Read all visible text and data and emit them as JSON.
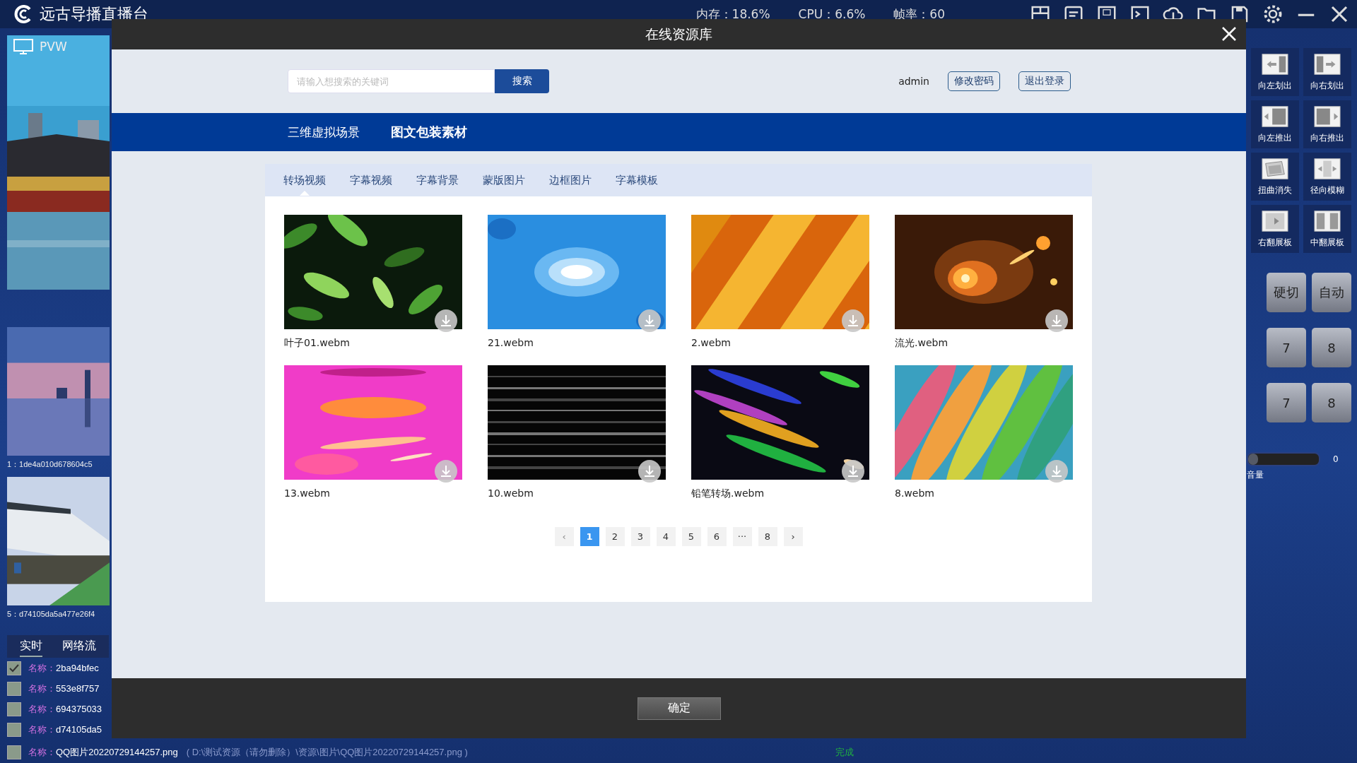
{
  "app": {
    "title": "远古导播直播台",
    "stats": [
      "内存：18.6%",
      "CPU：6.6%",
      "帧率：60"
    ]
  },
  "preview": {
    "label": "PVW"
  },
  "sources": [
    {
      "label": "1：1de4a010d678604c5"
    },
    {
      "label": "5：d74105da5a477e26f4"
    }
  ],
  "source_tabs": [
    {
      "label": "实时",
      "selected": true
    },
    {
      "label": "网络流",
      "selected": false
    }
  ],
  "tasks": [
    {
      "prefix": "名称：",
      "name": "2ba94bfec",
      "checked": true
    },
    {
      "prefix": "名称：",
      "name": "553e8f757",
      "checked": false
    },
    {
      "prefix": "名称：",
      "name": "694375033",
      "checked": false
    },
    {
      "prefix": "名称：",
      "name": "d74105da5",
      "checked": false
    },
    {
      "prefix": "名称：",
      "name": "QQ图片20220729144257.png",
      "path": "( D:\\测试资源（请勿删除）\\资源\\图片\\QQ图片20220729144257.png )",
      "status": "完成",
      "checked": false
    }
  ],
  "transitions": [
    {
      "kind": "slide-left",
      "label": "向左划出"
    },
    {
      "kind": "slide-right",
      "label": "向右划出"
    },
    {
      "kind": "push-left",
      "label": "向左推出"
    },
    {
      "kind": "push-right",
      "label": "向右推出"
    },
    {
      "kind": "distort",
      "label": "扭曲消失"
    },
    {
      "kind": "radial",
      "label": "径向模糊"
    },
    {
      "kind": "flip-right",
      "label": "右翻展板"
    },
    {
      "kind": "flip-center",
      "label": "中翻展板"
    }
  ],
  "switch_buttons": [
    "硬切",
    "自动"
  ],
  "number_rows": [
    [
      "7",
      "8"
    ],
    [
      "7",
      "8"
    ]
  ],
  "volume": {
    "reading": "0",
    "label": "音量",
    "level": 0
  },
  "dialog": {
    "title": "在线资源库",
    "search": {
      "placeholder": "请输入想搜索的关键词",
      "button": "搜索"
    },
    "user": "admin",
    "account_buttons": [
      "修改密码",
      "退出登录"
    ],
    "nav": [
      {
        "label": "三维虚拟场景",
        "selected": false
      },
      {
        "label": "图文包装素材",
        "selected": true
      }
    ],
    "tabs": [
      {
        "label": "转场视频",
        "selected": true
      },
      {
        "label": "字幕视频",
        "selected": false
      },
      {
        "label": "字幕背景",
        "selected": false
      },
      {
        "label": "蒙版图片",
        "selected": false
      },
      {
        "label": "边框图片",
        "selected": false
      },
      {
        "label": "字幕模板",
        "selected": false
      }
    ],
    "items": [
      {
        "name": "叶子01.webm"
      },
      {
        "name": "21.webm"
      },
      {
        "name": "2.webm"
      },
      {
        "name": "流光.webm"
      },
      {
        "name": "13.webm"
      },
      {
        "name": "10.webm"
      },
      {
        "name": "铅笔转场.webm"
      },
      {
        "name": "8.webm"
      }
    ],
    "pagination": [
      {
        "label": "1",
        "selected": true
      },
      {
        "label": "2",
        "selected": false
      },
      {
        "label": "3",
        "selected": false
      },
      {
        "label": "4",
        "selected": false
      },
      {
        "label": "5",
        "selected": false
      },
      {
        "label": "6",
        "selected": false
      },
      {
        "label": "···",
        "selected": false
      },
      {
        "label": "8",
        "selected": false
      }
    ],
    "prev": "‹",
    "next": "›",
    "confirm": "确定"
  }
}
